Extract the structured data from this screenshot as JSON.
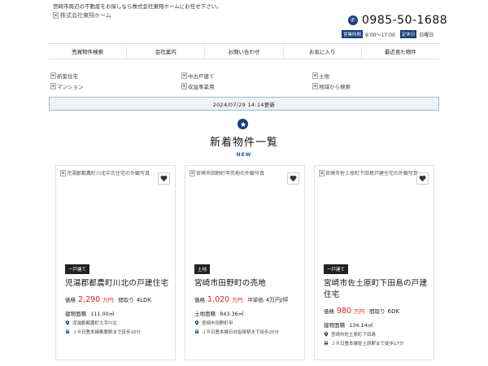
{
  "header": {
    "tagline": "宮崎市周辺の不動産をお探しなら株式会社東翔ホームにお任せ下さい。",
    "logo_alt": "株式会社東翔ホーム",
    "phone": "0985-50-1688",
    "hours_label": "営業時間",
    "hours_value": "9:00～17:00",
    "holiday_label": "定休日",
    "holiday_value": "日曜日"
  },
  "nav": [
    {
      "label": "売買物件検索"
    },
    {
      "label": "会社案内"
    },
    {
      "label": "お問い合わせ"
    },
    {
      "label": "お気に入り"
    },
    {
      "label": "最近見た物件"
    }
  ],
  "categories": [
    {
      "label": "新築住宅"
    },
    {
      "label": "中古戸建て"
    },
    {
      "label": "土地"
    },
    {
      "label": "マンション"
    },
    {
      "label": "収益事業用"
    },
    {
      "label": "地域から検索"
    }
  ],
  "updated": "2024/07/29 14:14更新",
  "section": {
    "title": "新着物件一覧",
    "subtitle": "NEW"
  },
  "cards": [
    {
      "photo_alt": "児湯郡都農町川北中古住宅の外観写真",
      "type": "一戸建て",
      "title": "児湯郡都農町川北の戸建住宅",
      "price_label": "価格",
      "price": "2,290",
      "price_unit": "万円",
      "sub_label": "間取り",
      "sub_value": "4LDK",
      "area_label": "建物面積",
      "area_value": "111.00㎡",
      "address": "児湯郡都農町大字川北",
      "access": "ＪＲ日豊本線都農駅まで徒歩10分"
    },
    {
      "photo_alt": "宮崎市田野町甲売地の外観写真",
      "type": "土地",
      "title": "宮崎市田野町の売地",
      "price_label": "価格",
      "price": "1,020",
      "price_unit": "万円",
      "sub_label": "坪単価",
      "sub_value": "4万円/坪",
      "area_label": "土地面積",
      "area_value": "843.36㎡",
      "address": "宮崎市田野町甲",
      "access": "ＪＲ日豊本線日向沓掛駅まで徒歩20分"
    },
    {
      "photo_alt": "宮崎市佐土原町下田島戸建住宅の外観写真",
      "type": "一戸建て",
      "title": "宮崎市佐土原町下田島の戸建住宅",
      "price_label": "価格",
      "price": "980",
      "price_unit": "万円",
      "sub_label": "間取り",
      "sub_value": "6DK",
      "area_label": "建物面積",
      "area_value": "134.14㎡",
      "address": "宮崎市佐土原町下田島",
      "access": "ＪＲ日豊本線佐土原駅まで徒歩17分"
    }
  ]
}
